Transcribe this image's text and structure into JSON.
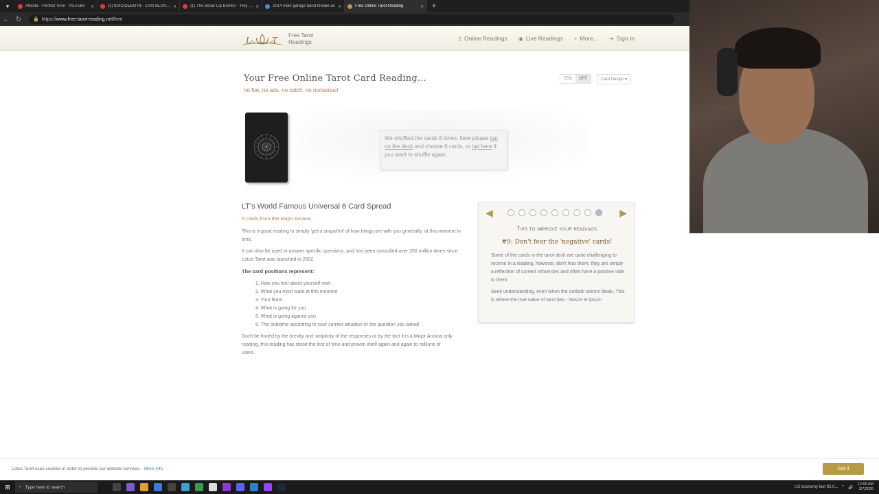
{
  "browser": {
    "tabs": [
      {
        "title": "Atlanta - Perfect Time - YouTube",
        "color": "#e03b3b",
        "active": false
      },
      {
        "title": "(1) $UICIDEBOY$ - 1000 BLUNTS",
        "color": "#e03b3b",
        "active": false
      },
      {
        "title": "(1) The Belair Lip Bombs - 'Hey Yo",
        "color": "#e03b3b",
        "active": false
      },
      {
        "title": "2014 indie garage band female ac",
        "color": "#4a88e0",
        "active": false
      },
      {
        "title": "Free Online Tarot Reading",
        "color": "#b89a44",
        "active": true
      }
    ],
    "url_prefix": "https://",
    "url_host": "www.free-tarot-reading.net",
    "url_path": "/free"
  },
  "site": {
    "logo_text_line1": "Free Tarot",
    "logo_text_line2": "Readings",
    "nav": [
      {
        "label": "Online Readings",
        "icon": "book-icon"
      },
      {
        "label": "Live Readings",
        "icon": "eye-icon"
      },
      {
        "label": "More...",
        "icon": "plus-icon"
      },
      {
        "label": "Sign In",
        "icon": "signin-icon"
      }
    ]
  },
  "main": {
    "title": "Your Free Online Tarot Card Reading...",
    "subtitle": "no fee, no ads, no catch, no nonsense!",
    "zen_label": "ZEN",
    "zen_state": "OFF",
    "card_design_label": "Card Design",
    "shuffle_text_1": "We shuffled the cards 8 times. Now please",
    "shuffle_link_1": "tap on the deck",
    "shuffle_text_2": "and choose 6 cards, or",
    "shuffle_link_2": "tap here",
    "shuffle_text_3": "if you want to shuffle again.",
    "spread_title": "LT's World Famous Universal 6 Card Spread",
    "spread_subtitle": "6 cards from the Major Arcana",
    "para1_a": "This is a good reading to simply",
    "para1_em": "'get a snapshot'",
    "para1_b": "of how things are with you generally, at this moment in time.",
    "para2_a": "It can also be used to answer specific questions, and has been consulted over 200",
    "para2_em": "million",
    "para2_b": "times since Lotus Tarot was launched in 2002.",
    "positions_heading": "The card positions represent:",
    "positions": [
      "1. How you feel about yourself now",
      "2. What you most want at this moment",
      "3. Your fears",
      "4. What is going for you",
      "5. What is going against you",
      "6. The outcome according to your current situation or the question you asked"
    ],
    "para3": "Don't be fooled by the brevity and simplicity of the responses or by the fact it is a Major Arcana only reading, this reading has stood the test of time and proven itself again and again to millions of users."
  },
  "tips": {
    "title": "Tips to improve your readings",
    "dot_count": 9,
    "active_dot": 8,
    "heading": "#9: Don't fear the 'negative' cards!",
    "body1": "Some of the cards in the tarot deck are quite challenging to receive in a reading, however, don't fear them, they are simply a reflection of current influences and often have a positive side to them.",
    "body2_a": "Seek understanding, even when the outlook seems bleak. This is where the true value of tarot lies -",
    "body2_em": "Nosce te ipsum"
  },
  "cookie": {
    "text": "Lotus Tarot uses cookies in order to provide our website services.",
    "more": "More info",
    "button": "Got It"
  },
  "taskbar": {
    "search_placeholder": "Type here to search",
    "news": "US economy lost 92,0...",
    "time": "12:55 AM",
    "date": "3/7/2026"
  }
}
